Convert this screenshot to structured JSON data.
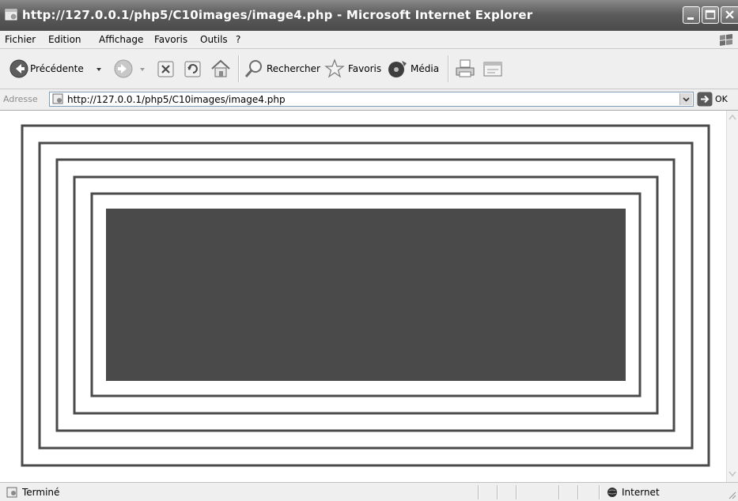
{
  "window": {
    "title": "http://127.0.0.1/php5/C10images/image4.php - Microsoft Internet Explorer",
    "buttons": [
      "minimize",
      "maximize",
      "close"
    ]
  },
  "menu": {
    "items": [
      "Fichier",
      "Edition",
      "Affichage",
      "Favoris",
      "Outils",
      "?"
    ]
  },
  "toolbar": {
    "back_label": "Précédente",
    "search_label": "Rechercher",
    "favorites_label": "Favoris",
    "media_label": "Média",
    "icons": [
      "back-icon",
      "forward-icon",
      "stop-icon",
      "refresh-icon",
      "home-icon",
      "search-icon",
      "favorites-star-icon",
      "media-icon",
      "print-icon",
      "edit-icon"
    ]
  },
  "address": {
    "label": "Adresse",
    "url": "http://127.0.0.1/php5/C10images/image4.php",
    "go_label": "OK"
  },
  "page_image": {
    "frame_count": 5,
    "fill_color": "#4a4a4a",
    "line_color": "#4a4a4a"
  },
  "status": {
    "text": "Terminé",
    "zone": "Internet"
  },
  "colors": {
    "titlebar": "#5c5c5c",
    "chrome": "#efefef"
  }
}
